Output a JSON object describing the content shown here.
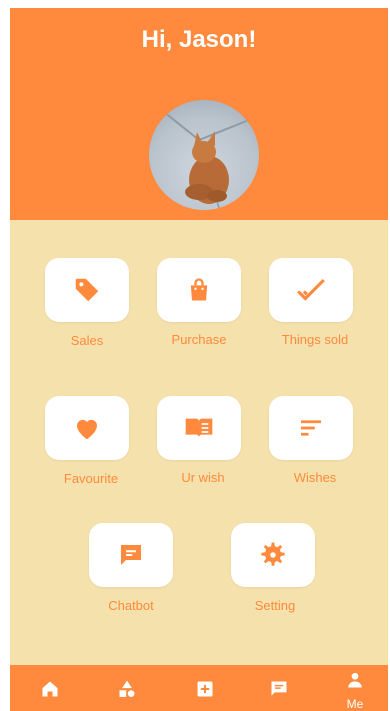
{
  "header": {
    "greeting": "Hi, Jason!"
  },
  "profile": {
    "avatar_icon": "cat-photo"
  },
  "menu": [
    {
      "label": "Sales",
      "icon": "tag-icon"
    },
    {
      "label": "Purchase",
      "icon": "shopping-bag-icon"
    },
    {
      "label": "Things sold",
      "icon": "checkmark-icon"
    },
    {
      "label": "Favourite",
      "icon": "heart-icon"
    },
    {
      "label": "Ur wish",
      "icon": "book-icon"
    },
    {
      "label": "Wishes",
      "icon": "list-icon"
    },
    {
      "label": "Chatbot",
      "icon": "chat-icon"
    },
    {
      "label": "Setting",
      "icon": "gear-icon"
    }
  ],
  "bottom_nav": {
    "items": [
      {
        "id": "home",
        "icon": "home-icon"
      },
      {
        "id": "categories",
        "icon": "shapes-icon"
      },
      {
        "id": "add",
        "icon": "add-box-icon"
      },
      {
        "id": "messages",
        "icon": "chat-icon"
      },
      {
        "id": "me",
        "icon": "person-icon",
        "label": "Me"
      }
    ]
  },
  "colors": {
    "accent": "#FF8A3D",
    "background": "#F5E1AC",
    "tile": "#FFFFFF"
  }
}
